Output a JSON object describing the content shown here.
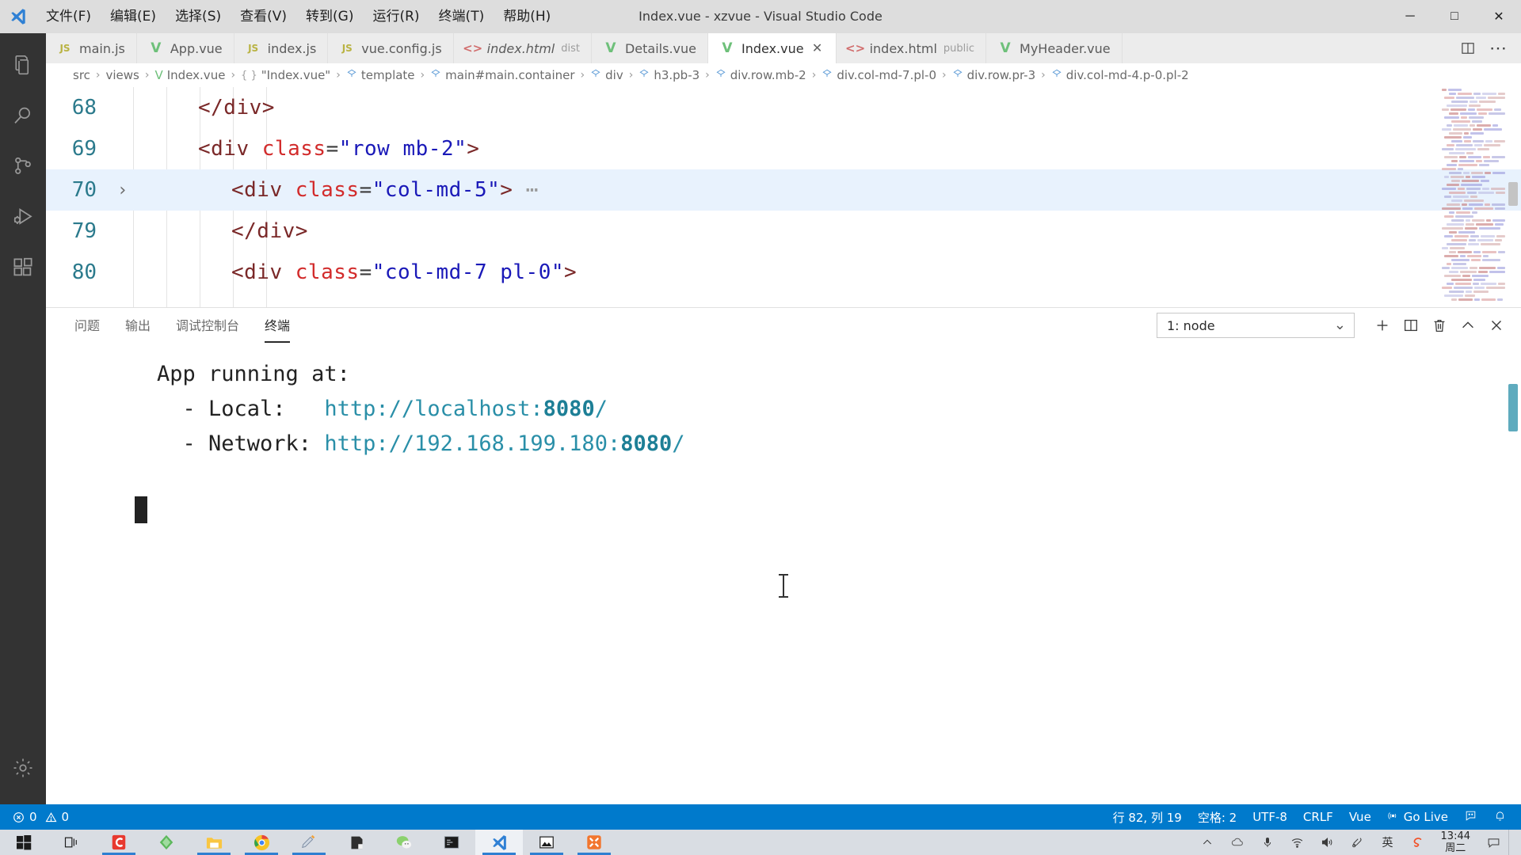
{
  "window": {
    "title": "Index.vue - xzvue - Visual Studio Code",
    "logo_icon": "vscode-logo-icon",
    "controls": [
      {
        "name": "minimize-button",
        "glyph": "─"
      },
      {
        "name": "maximize-button",
        "glyph": "□"
      },
      {
        "name": "close-button",
        "glyph": "✕"
      }
    ]
  },
  "menubar": {
    "items": [
      {
        "label": "文件(F)",
        "name": "menu-file"
      },
      {
        "label": "编辑(E)",
        "name": "menu-edit"
      },
      {
        "label": "选择(S)",
        "name": "menu-selection"
      },
      {
        "label": "查看(V)",
        "name": "menu-view"
      },
      {
        "label": "转到(G)",
        "name": "menu-go"
      },
      {
        "label": "运行(R)",
        "name": "menu-run"
      },
      {
        "label": "终端(T)",
        "name": "menu-terminal"
      },
      {
        "label": "帮助(H)",
        "name": "menu-help"
      }
    ]
  },
  "activitybar": {
    "items": [
      {
        "name": "explorer-icon",
        "label": "Explorer",
        "active": false
      },
      {
        "name": "search-icon",
        "label": "Search",
        "active": false
      },
      {
        "name": "source-control-icon",
        "label": "Source Control",
        "active": false
      },
      {
        "name": "run-and-debug-icon",
        "label": "Run and Debug",
        "active": false
      },
      {
        "name": "extensions-icon",
        "label": "Extensions",
        "active": false
      }
    ],
    "bottom": [
      {
        "name": "settings-gear-icon",
        "label": "Manage"
      }
    ]
  },
  "tabs": [
    {
      "label": "main.js",
      "icon": "js-file-icon",
      "icon_type": "js",
      "sub": "",
      "active": false,
      "italic": false,
      "closable": false
    },
    {
      "label": "App.vue",
      "icon": "vue-file-icon",
      "icon_type": "vue",
      "sub": "",
      "active": false,
      "italic": false,
      "closable": false
    },
    {
      "label": "index.js",
      "icon": "js-file-icon",
      "icon_type": "js",
      "sub": "",
      "active": false,
      "italic": false,
      "closable": false
    },
    {
      "label": "vue.config.js",
      "icon": "js-file-icon",
      "icon_type": "js",
      "sub": "",
      "active": false,
      "italic": false,
      "closable": false
    },
    {
      "label": "index.html",
      "icon": "html-file-icon",
      "icon_type": "html",
      "sub": "dist",
      "active": false,
      "italic": true,
      "closable": false
    },
    {
      "label": "Details.vue",
      "icon": "vue-file-icon",
      "icon_type": "vue",
      "sub": "",
      "active": false,
      "italic": false,
      "closable": false
    },
    {
      "label": "Index.vue",
      "icon": "vue-file-icon",
      "icon_type": "vue",
      "sub": "",
      "active": true,
      "italic": false,
      "closable": true
    },
    {
      "label": "index.html",
      "icon": "html-file-icon",
      "icon_type": "html",
      "sub": "public",
      "active": false,
      "italic": false,
      "closable": false
    },
    {
      "label": "MyHeader.vue",
      "icon": "vue-file-icon",
      "icon_type": "vue",
      "sub": "",
      "active": false,
      "italic": false,
      "closable": false
    }
  ],
  "tabbar_actions": [
    {
      "name": "split-editor-button",
      "glyph": "◫"
    },
    {
      "name": "more-actions-button",
      "glyph": "⋯"
    }
  ],
  "tab_close_glyph": "✕",
  "breadcrumb": [
    {
      "label": "src",
      "icon": ""
    },
    {
      "label": "views",
      "icon": ""
    },
    {
      "label": "Index.vue",
      "icon": "vue"
    },
    {
      "label": "\"Index.vue\"",
      "icon": "braces"
    },
    {
      "label": "template",
      "icon": "tag"
    },
    {
      "label": "main#main.container",
      "icon": "tag"
    },
    {
      "label": "div",
      "icon": "tag"
    },
    {
      "label": "h3.pb-3",
      "icon": "tag"
    },
    {
      "label": "div.row.mb-2",
      "icon": "tag"
    },
    {
      "label": "div.col-md-7.pl-0",
      "icon": "tag"
    },
    {
      "label": "div.row.pr-3",
      "icon": "tag"
    },
    {
      "label": "div.col-md-4.p-0.pl-2",
      "icon": "tag"
    }
  ],
  "breadcrumb_sep": "›",
  "editor": {
    "lines": [
      {
        "number": "68",
        "fold": "",
        "indent": 2,
        "highlight": false,
        "tokens": [
          {
            "t": "</div>",
            "c": "tag"
          }
        ]
      },
      {
        "number": "69",
        "fold": "",
        "indent": 2,
        "highlight": false,
        "tokens": [
          {
            "t": "<div ",
            "c": "tag"
          },
          {
            "t": "class",
            "c": "attr"
          },
          {
            "t": "=",
            "c": "eq"
          },
          {
            "t": "\"row mb-2\"",
            "c": "str"
          },
          {
            "t": ">",
            "c": "tag"
          }
        ]
      },
      {
        "number": "70",
        "fold": "›",
        "indent": 3,
        "highlight": true,
        "tokens": [
          {
            "t": "<div ",
            "c": "tag"
          },
          {
            "t": "class",
            "c": "attr"
          },
          {
            "t": "=",
            "c": "eq"
          },
          {
            "t": "\"col-md-5\"",
            "c": "str"
          },
          {
            "t": ">",
            "c": "tag"
          },
          {
            "t": " ⋯",
            "c": "dots"
          }
        ]
      },
      {
        "number": "79",
        "fold": "",
        "indent": 3,
        "highlight": false,
        "tokens": [
          {
            "t": "</div>",
            "c": "tag"
          }
        ]
      },
      {
        "number": "80",
        "fold": "",
        "indent": 3,
        "highlight": false,
        "tokens": [
          {
            "t": "<div ",
            "c": "tag"
          },
          {
            "t": "class",
            "c": "attr"
          },
          {
            "t": "=",
            "c": "eq"
          },
          {
            "t": "\"col-md-7 pl-0\"",
            "c": "str"
          },
          {
            "t": ">",
            "c": "tag"
          }
        ]
      }
    ]
  },
  "panel": {
    "tabs": [
      {
        "label": "问题",
        "name": "panel-tab-problems",
        "active": false
      },
      {
        "label": "输出",
        "name": "panel-tab-output",
        "active": false
      },
      {
        "label": "调试控制台",
        "name": "panel-tab-debug-console",
        "active": false
      },
      {
        "label": "终端",
        "name": "panel-tab-terminal",
        "active": true
      }
    ],
    "terminal_select": {
      "value": "1: node",
      "chevron": "⌄"
    },
    "actions": [
      {
        "name": "new-terminal-button",
        "glyph": "+"
      },
      {
        "name": "split-terminal-button",
        "glyph": "◫"
      },
      {
        "name": "kill-terminal-button",
        "glyph": "🗑"
      },
      {
        "name": "maximize-panel-button",
        "glyph": "∧"
      },
      {
        "name": "close-panel-button",
        "glyph": "✕"
      }
    ]
  },
  "terminal": {
    "lines": [
      {
        "segments": [
          {
            "t": "App running at:",
            "c": "plain"
          }
        ]
      },
      {
        "segments": [
          {
            "t": "  - Local:   ",
            "c": "plain"
          },
          {
            "t": "http://localhost:",
            "c": "url"
          },
          {
            "t": "8080",
            "c": "port"
          },
          {
            "t": "/",
            "c": "url"
          }
        ]
      },
      {
        "segments": [
          {
            "t": "  - Network: ",
            "c": "plain"
          },
          {
            "t": "http://192.168.199.180:",
            "c": "url"
          },
          {
            "t": "8080",
            "c": "port"
          },
          {
            "t": "/",
            "c": "url"
          }
        ]
      }
    ]
  },
  "statusbar": {
    "left": [
      {
        "name": "status-errors-warnings",
        "icon": "error-circle-icon",
        "text": "0",
        "icon2": "warning-triangle-icon",
        "text2": "0"
      }
    ],
    "right": [
      {
        "name": "status-cursor-position",
        "label": "行 82, 列 19"
      },
      {
        "name": "status-indentation",
        "label": "空格: 2"
      },
      {
        "name": "status-encoding",
        "label": "UTF-8"
      },
      {
        "name": "status-eol",
        "label": "CRLF"
      },
      {
        "name": "status-language-mode",
        "label": "Vue"
      },
      {
        "name": "status-go-live",
        "label": "Go Live",
        "icon": "broadcast-icon"
      },
      {
        "name": "status-feedback",
        "label": "",
        "icon": "feedback-smiley-icon"
      },
      {
        "name": "status-notifications",
        "label": "",
        "icon": "bell-icon"
      }
    ]
  },
  "taskbar": {
    "start": {
      "name": "start-button",
      "icon": "windows-logo-icon"
    },
    "items": [
      {
        "name": "taskview-button",
        "icon": "task-view-icon",
        "running": false,
        "active": false
      },
      {
        "name": "taskbar-cdr",
        "icon": "coreldraw-icon",
        "running": true,
        "active": false
      },
      {
        "name": "taskbar-gitkraken",
        "icon": "green-app-icon",
        "running": false,
        "active": false
      },
      {
        "name": "taskbar-explorer",
        "icon": "file-explorer-icon",
        "running": true,
        "active": false
      },
      {
        "name": "taskbar-chrome",
        "icon": "chrome-icon",
        "running": true,
        "active": false
      },
      {
        "name": "taskbar-paint",
        "icon": "paint-icon",
        "running": true,
        "active": false
      },
      {
        "name": "taskbar-notepad",
        "icon": "notes-icon",
        "running": false,
        "active": false
      },
      {
        "name": "taskbar-wechat",
        "icon": "wechat-icon",
        "running": false,
        "active": false
      },
      {
        "name": "taskbar-terminal",
        "icon": "console-icon",
        "running": false,
        "active": false
      },
      {
        "name": "taskbar-vscode",
        "icon": "vscode-icon",
        "running": true,
        "active": true
      },
      {
        "name": "taskbar-photos",
        "icon": "photos-icon",
        "running": true,
        "active": false
      },
      {
        "name": "taskbar-xampp",
        "icon": "xampp-icon",
        "running": true,
        "active": false
      }
    ],
    "tray": [
      {
        "name": "tray-show-hidden-icon",
        "glyph": "∧"
      },
      {
        "name": "tray-onedrive-icon",
        "glyph": "☁"
      },
      {
        "name": "tray-microphone-icon",
        "glyph": "🎤"
      },
      {
        "name": "tray-wifi-icon",
        "glyph": "📶"
      },
      {
        "name": "tray-volume-icon",
        "glyph": "🔊"
      },
      {
        "name": "tray-pen-icon",
        "glyph": "✎"
      },
      {
        "name": "tray-ime-icon",
        "glyph": "英"
      },
      {
        "name": "tray-sogou-icon",
        "glyph": "S"
      }
    ],
    "clock": {
      "time": "13:44",
      "date": "周二"
    },
    "notification": {
      "name": "action-center-button",
      "glyph": "⬜"
    }
  }
}
